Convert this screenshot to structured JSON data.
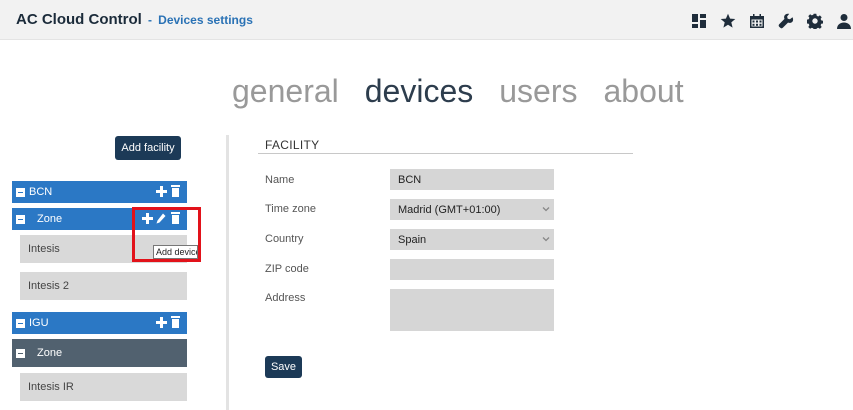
{
  "header": {
    "app_title": "AC Cloud Control",
    "separator": "-",
    "subtitle": "Devices settings",
    "icons": [
      "dashboard-icon",
      "star-icon",
      "calendar-icon",
      "wrench-icon",
      "gear-icon",
      "user-icon"
    ]
  },
  "tabs": [
    {
      "label": "general",
      "active": false
    },
    {
      "label": "devices",
      "active": true
    },
    {
      "label": "users",
      "active": false
    },
    {
      "label": "about",
      "active": false
    }
  ],
  "sidebar": {
    "add_facility_label": "Add facility",
    "facility_bcn": "BCN",
    "zone_bcn": "Zone",
    "device_1": "Intesis",
    "device_2": "Intesis 2",
    "facility_igu": "IGU",
    "zone_igu": "Zone",
    "device_3": "Intesis IR",
    "tooltip": "Add device"
  },
  "form": {
    "section_title": "FACILITY",
    "name_label": "Name",
    "name_value": "BCN",
    "timezone_label": "Time zone",
    "timezone_value": "Madrid (GMT+01:00)",
    "country_label": "Country",
    "country_value": "Spain",
    "zip_label": "ZIP code",
    "zip_value": "",
    "address_label": "Address",
    "address_value": "",
    "save_label": "Save"
  },
  "colors": {
    "header_bg": "#f2f2f2",
    "brand_dark": "#1b2b3a",
    "subtitle_blue": "#2a72b5",
    "sidebar_blue": "#2b78c5",
    "zone_dark": "#51616f",
    "button_dark": "#1c3a57",
    "highlight_red": "#e2121a"
  }
}
